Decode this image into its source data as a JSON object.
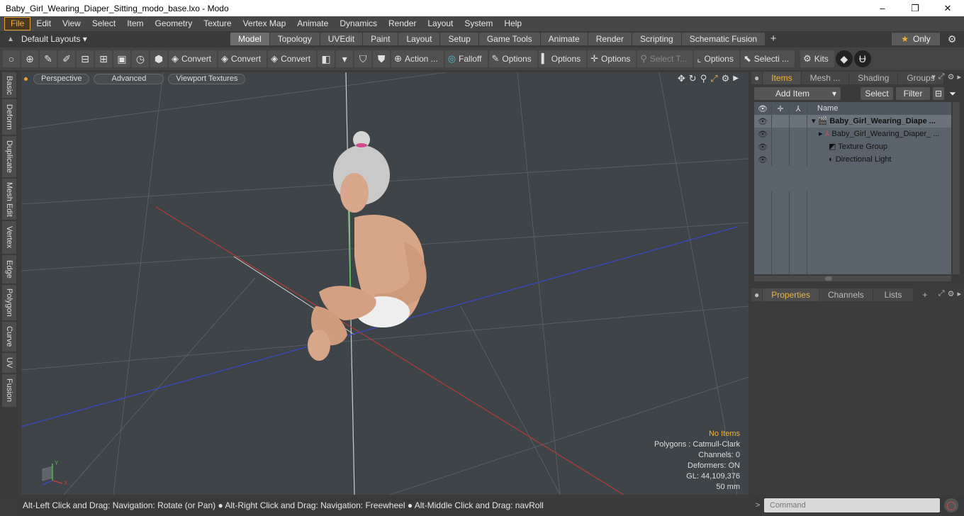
{
  "window": {
    "title": "Baby_Girl_Wearing_Diaper_Sitting_modo_base.lxo - Modo",
    "minimize": "–",
    "maximize": "❐",
    "close": "✕"
  },
  "menu": [
    "File",
    "Edit",
    "View",
    "Select",
    "Item",
    "Geometry",
    "Texture",
    "Vertex Map",
    "Animate",
    "Dynamics",
    "Render",
    "Layout",
    "System",
    "Help"
  ],
  "layout": {
    "selector": "Default Layouts ▾",
    "tabs": [
      "Model",
      "Topology",
      "UVEdit",
      "Paint",
      "Layout",
      "Setup",
      "Game Tools",
      "Animate",
      "Render",
      "Scripting",
      "Schematic Fusion"
    ],
    "active_tab": "Model",
    "plus": "+",
    "only_label": "Only"
  },
  "toolbar": {
    "convert1": "Convert",
    "convert2": "Convert",
    "convert3": "Convert",
    "action": "Action ...",
    "falloff": "Falloff",
    "options1": "Options",
    "options2": "Options",
    "options3": "Options",
    "select_t": "Select T...",
    "options4": "Options",
    "selecti": "Selecti ...",
    "kits": "Kits"
  },
  "left_tabs": [
    "Basic",
    "Deform",
    "Duplicate",
    "Mesh Edit",
    "Vertex",
    "Edge",
    "Polygon",
    "Curve",
    "UV",
    "Fusion"
  ],
  "viewport": {
    "perspective": "Perspective",
    "advanced": "Advanced",
    "textures": "Viewport Textures",
    "info": {
      "no_items": "No Items",
      "polygons": "Polygons : Catmull-Clark",
      "channels": "Channels: 0",
      "deformers": "Deformers: ON",
      "gl": "GL: 44,109,376",
      "size": "50 mm"
    },
    "axis_x": "X",
    "axis_y": "Y"
  },
  "status": "Alt-Left Click and Drag: Navigation: Rotate (or Pan) ● Alt-Right Click and Drag: Navigation: Freewheel ● Alt-Middle Click and Drag: navRoll",
  "items_panel": {
    "tabs": [
      "Items",
      "Mesh ...",
      "Shading",
      "Groups"
    ],
    "add_item": "Add Item",
    "select": "Select",
    "filter": "Filter",
    "name_header": "Name",
    "rows": [
      {
        "name": "Baby_Girl_Wearing_Diape ...",
        "icon": "🎬"
      },
      {
        "name": "Baby_Girl_Wearing_Diaper_ ...",
        "icon": "⅄"
      },
      {
        "name": "Texture Group",
        "icon": "◩"
      },
      {
        "name": "Directional Light",
        "icon": "◐"
      }
    ]
  },
  "properties_panel": {
    "tabs": [
      "Properties",
      "Channels",
      "Lists"
    ],
    "plus": "+"
  },
  "command": {
    "placeholder": "Command",
    "arrow": ">"
  }
}
